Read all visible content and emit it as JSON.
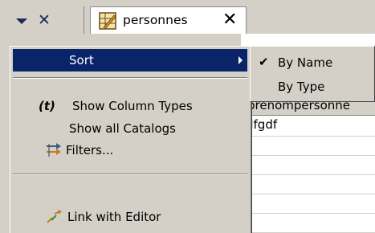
{
  "toolbar": {
    "close_glyph": "✕"
  },
  "tab": {
    "label": "personnes",
    "close_glyph": "✕"
  },
  "table": {
    "header_fragment": "prenompersonne",
    "cell_fragment": "dfgdf"
  },
  "menu": {
    "items": [
      {
        "label": "Sort",
        "selected": true,
        "has_submenu": true
      },
      {
        "prefix": "(t)",
        "label": "Show Column Types"
      },
      {
        "label": "Show all Catalogs"
      },
      {
        "label": "Filters...",
        "icon": "filters-icon"
      },
      {
        "label": "Link with Editor",
        "icon": "link-with-editor-icon"
      }
    ]
  },
  "submenu": {
    "items": [
      {
        "label": "By Name",
        "checked": true,
        "check_glyph": "✔"
      },
      {
        "label": "By Type",
        "checked": false
      }
    ]
  },
  "colors": {
    "selection": "#0a246a",
    "menu_bg": "#d4d0c8"
  }
}
